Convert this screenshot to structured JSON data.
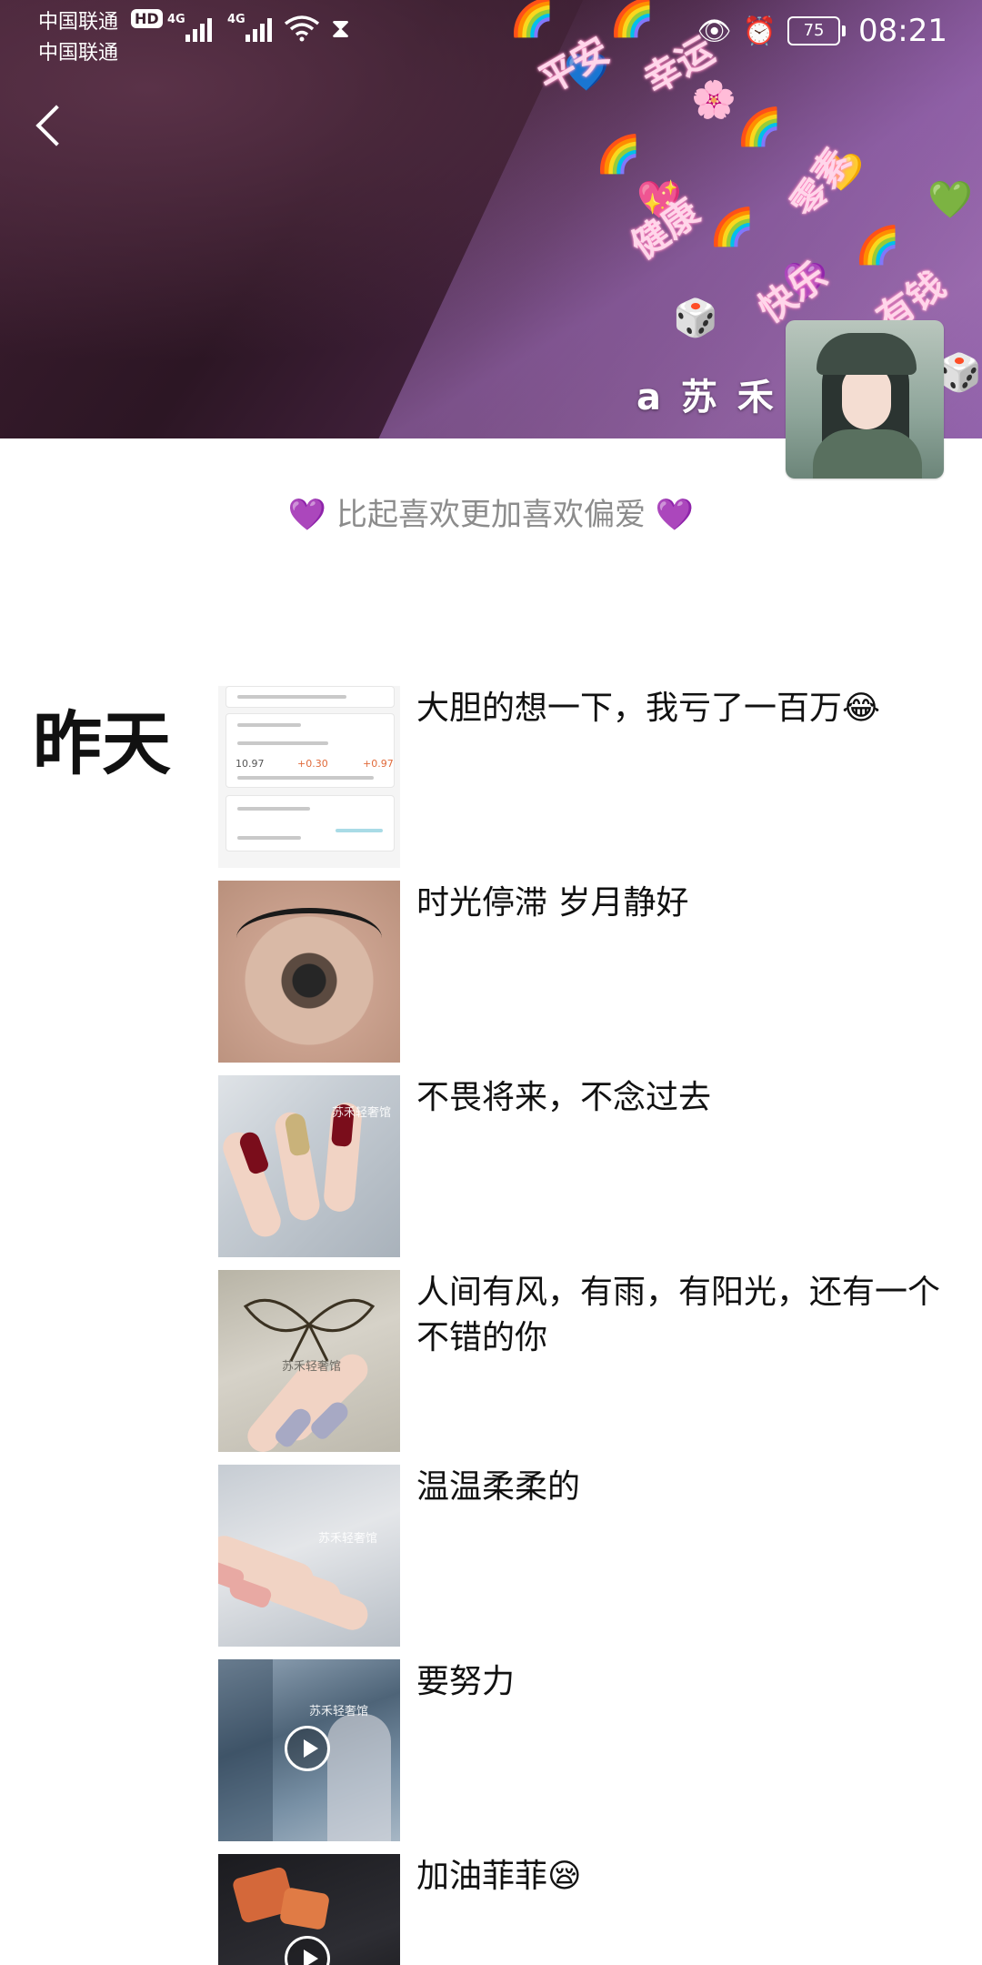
{
  "status_bar": {
    "carrier1": "中国联通",
    "carrier2": "中国联通",
    "hd": "HD",
    "network1": "4G",
    "network2": "4G",
    "battery": "75",
    "time": "08:21"
  },
  "profile": {
    "name": "a 苏 禾",
    "signature_prefix": "💜",
    "signature": "比起喜欢更加喜欢偏爱",
    "signature_suffix": "💜",
    "cover_words": [
      "幸运",
      "平安",
      "健康",
      "快乐",
      "有钱",
      "零素"
    ]
  },
  "feed": {
    "day_label": "昨天",
    "posts": [
      {
        "caption": "大胆的想一下，我亏了一百万😂",
        "thumb_nums": [
          "10.97",
          "+0.30",
          "+0.97"
        ]
      },
      {
        "caption": "时光停滞 岁月静好"
      },
      {
        "caption": "不畏将来，不念过去",
        "watermark": "苏禾轻奢馆"
      },
      {
        "caption": "人间有风，有雨，有阳光，还有一个不错的你",
        "watermark": "苏禾轻奢馆"
      },
      {
        "caption": "温温柔柔的",
        "watermark": "苏禾轻奢馆"
      },
      {
        "caption": "要努力",
        "watermark": "苏禾轻奢馆",
        "is_video": true
      },
      {
        "caption": "加油菲菲😪",
        "is_video": true
      }
    ]
  }
}
